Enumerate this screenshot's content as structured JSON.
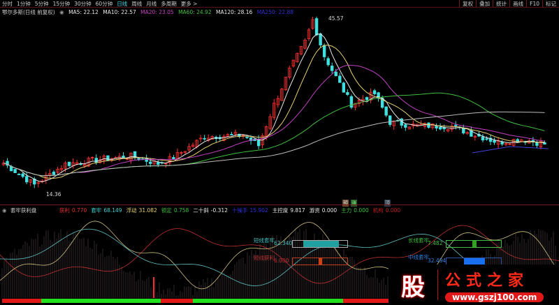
{
  "toolbar": {
    "periods": [
      "分时",
      "1分钟",
      "5分钟",
      "15分钟",
      "30分钟",
      "60分钟",
      "日线",
      "周线",
      "月线",
      "多周期",
      "更多 >"
    ],
    "active": "日线",
    "right_buttons": [
      "复权",
      "叠加",
      "统计",
      "画线",
      "F10",
      "标记"
    ]
  },
  "info": {
    "title": "鄂尔多斯(日线 前复权)",
    "ma5": "MA5: 22.12",
    "ma10": "MA10: 22.57",
    "ma20": "MA20: 23.05",
    "ma60": "MA60: 24.92",
    "ma120": "MA120: 28.16",
    "ma250": "MA250: 22.88"
  },
  "colors": {
    "ma5": "#e8e8e8",
    "ma10": "#e8d070",
    "ma20": "#c040c0",
    "ma60": "#40c040",
    "ma120": "#e8e8e8",
    "ma250": "#4040e0",
    "up": "#ff3030",
    "down": "#40e0e0"
  },
  "price": {
    "high_label": "45.57",
    "low_label": "14.36",
    "path": [
      [
        0,
        18.5
      ],
      [
        8,
        14.4
      ],
      [
        16,
        18.3
      ],
      [
        25,
        19.2
      ],
      [
        33,
        19.8
      ],
      [
        40,
        18.4
      ],
      [
        44,
        19.5
      ],
      [
        52,
        23.5
      ],
      [
        62,
        23.8
      ],
      [
        66,
        21.8
      ],
      [
        70,
        29.5
      ],
      [
        74,
        36
      ],
      [
        78,
        41.4
      ],
      [
        80,
        45.5
      ],
      [
        83,
        38.7
      ],
      [
        87,
        33.4
      ],
      [
        90,
        29.6
      ],
      [
        96,
        31.6
      ],
      [
        100,
        26.2
      ],
      [
        106,
        25.6
      ],
      [
        116,
        25.4
      ],
      [
        120,
        24.3
      ],
      [
        128,
        22.4
      ],
      [
        134,
        23
      ],
      [
        140,
        22.1
      ]
    ]
  },
  "markers": [
    "预",
    "涨",
    "顶"
  ],
  "indicator": {
    "name": "套牢获利盘",
    "items": [
      {
        "k": "获利",
        "v": "0.770",
        "c": "#e03030"
      },
      {
        "k": "套牢",
        "v": "68.149",
        "c": "#40d0d0"
      },
      {
        "k": "浮动",
        "v": "31.082",
        "c": "#e8d070"
      },
      {
        "k": "锁定",
        "v": "0.758",
        "c": "#40c040"
      },
      {
        "k": "二十斜",
        "v": "-0.312",
        "c": "#e8e8e8"
      },
      {
        "k": "十操手",
        "v": "15.902",
        "c": "#3030e0"
      },
      {
        "k": "主控度",
        "v": "9.817",
        "c": "#e8e8e8"
      },
      {
        "k": "游资",
        "v": "0.000",
        "c": "#e8e8e8"
      },
      {
        "k": "主力",
        "v": "0.000",
        "c": "#40c040"
      },
      {
        "k": "机构",
        "v": "0.000",
        "c": "#c02020"
      }
    ]
  },
  "panels": {
    "short_trap": {
      "label": "短线套牢",
      "value": "62.340",
      "pct": 62
    },
    "short_profit": {
      "label": "短线获利",
      "value": "6.000",
      "pct": 6
    },
    "long_trap": {
      "label": "长线套牢",
      "value": "7.482",
      "pct": 7
    },
    "mid_trap": {
      "label": "中线套牢",
      "value": "32.494",
      "pct": 32
    }
  },
  "signals": [
    [
      "d",
      17
    ],
    [
      "u",
      52
    ],
    [
      "d",
      14
    ],
    [
      "u",
      5
    ],
    [
      "u",
      60
    ],
    [
      "d",
      26
    ],
    [
      "u",
      22
    ],
    [
      "d",
      3
    ],
    [
      "u",
      3
    ],
    [
      "d",
      3
    ],
    [
      "u",
      3
    ],
    [
      "d",
      27
    ],
    [
      "u",
      6
    ]
  ],
  "watermark": {
    "char": "股",
    "name": "公式之家",
    "url": "www.gszj100.com"
  }
}
